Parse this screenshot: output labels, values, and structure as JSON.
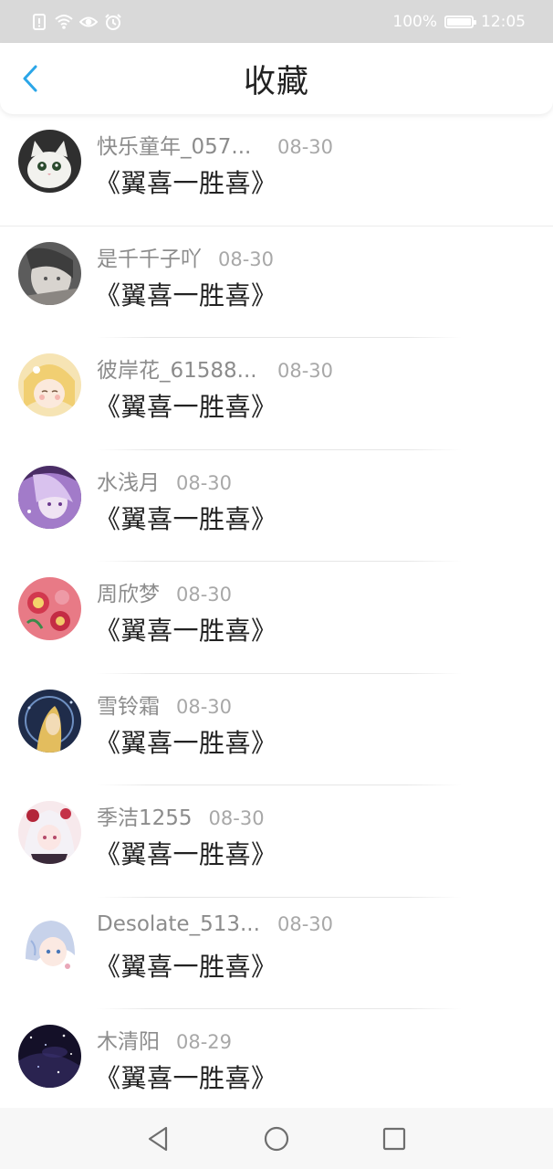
{
  "status_bar": {
    "battery": "100%",
    "time": "12:05",
    "icons": [
      "sim-alert-icon",
      "wifi-icon",
      "eye-icon",
      "alarm-icon"
    ]
  },
  "header": {
    "title": "收藏",
    "back_icon": "chevron-left-icon",
    "accent_color": "#2ba6e8"
  },
  "favorites": [
    {
      "user": "快乐童年_057...",
      "date": "08-30",
      "title": "《翼喜一胜喜》",
      "avatar_color": "#2f2f2f"
    },
    {
      "user": "是千千子吖",
      "date": "08-30",
      "title": "《翼喜一胜喜》",
      "avatar_color": "#6b6b6b"
    },
    {
      "user": "彼岸花_61588...",
      "date": "08-30",
      "title": "《翼喜一胜喜》",
      "avatar_color": "#f1d89a"
    },
    {
      "user": "水浅月",
      "date": "08-30",
      "title": "《翼喜一胜喜》",
      "avatar_color": "#8b5fb6"
    },
    {
      "user": "周欣梦",
      "date": "08-30",
      "title": "《翼喜一胜喜》",
      "avatar_color": "#e0707a"
    },
    {
      "user": "雪铃霜",
      "date": "08-30",
      "title": "《翼喜一胜喜》",
      "avatar_color": "#2b3a5a"
    },
    {
      "user": "季洁1255",
      "date": "08-30",
      "title": "《翼喜一胜喜》",
      "avatar_color": "#f0d6da"
    },
    {
      "user": "Desolate_513...",
      "date": "08-30",
      "title": "《翼喜一胜喜》",
      "avatar_color": "#cfd8ea"
    },
    {
      "user": "木清阳",
      "date": "08-29",
      "title": "《翼喜一胜喜》",
      "avatar_color": "#1a1630"
    }
  ],
  "nav": {
    "back": "triangle-back-icon",
    "home": "circle-home-icon",
    "recents": "square-recents-icon"
  }
}
